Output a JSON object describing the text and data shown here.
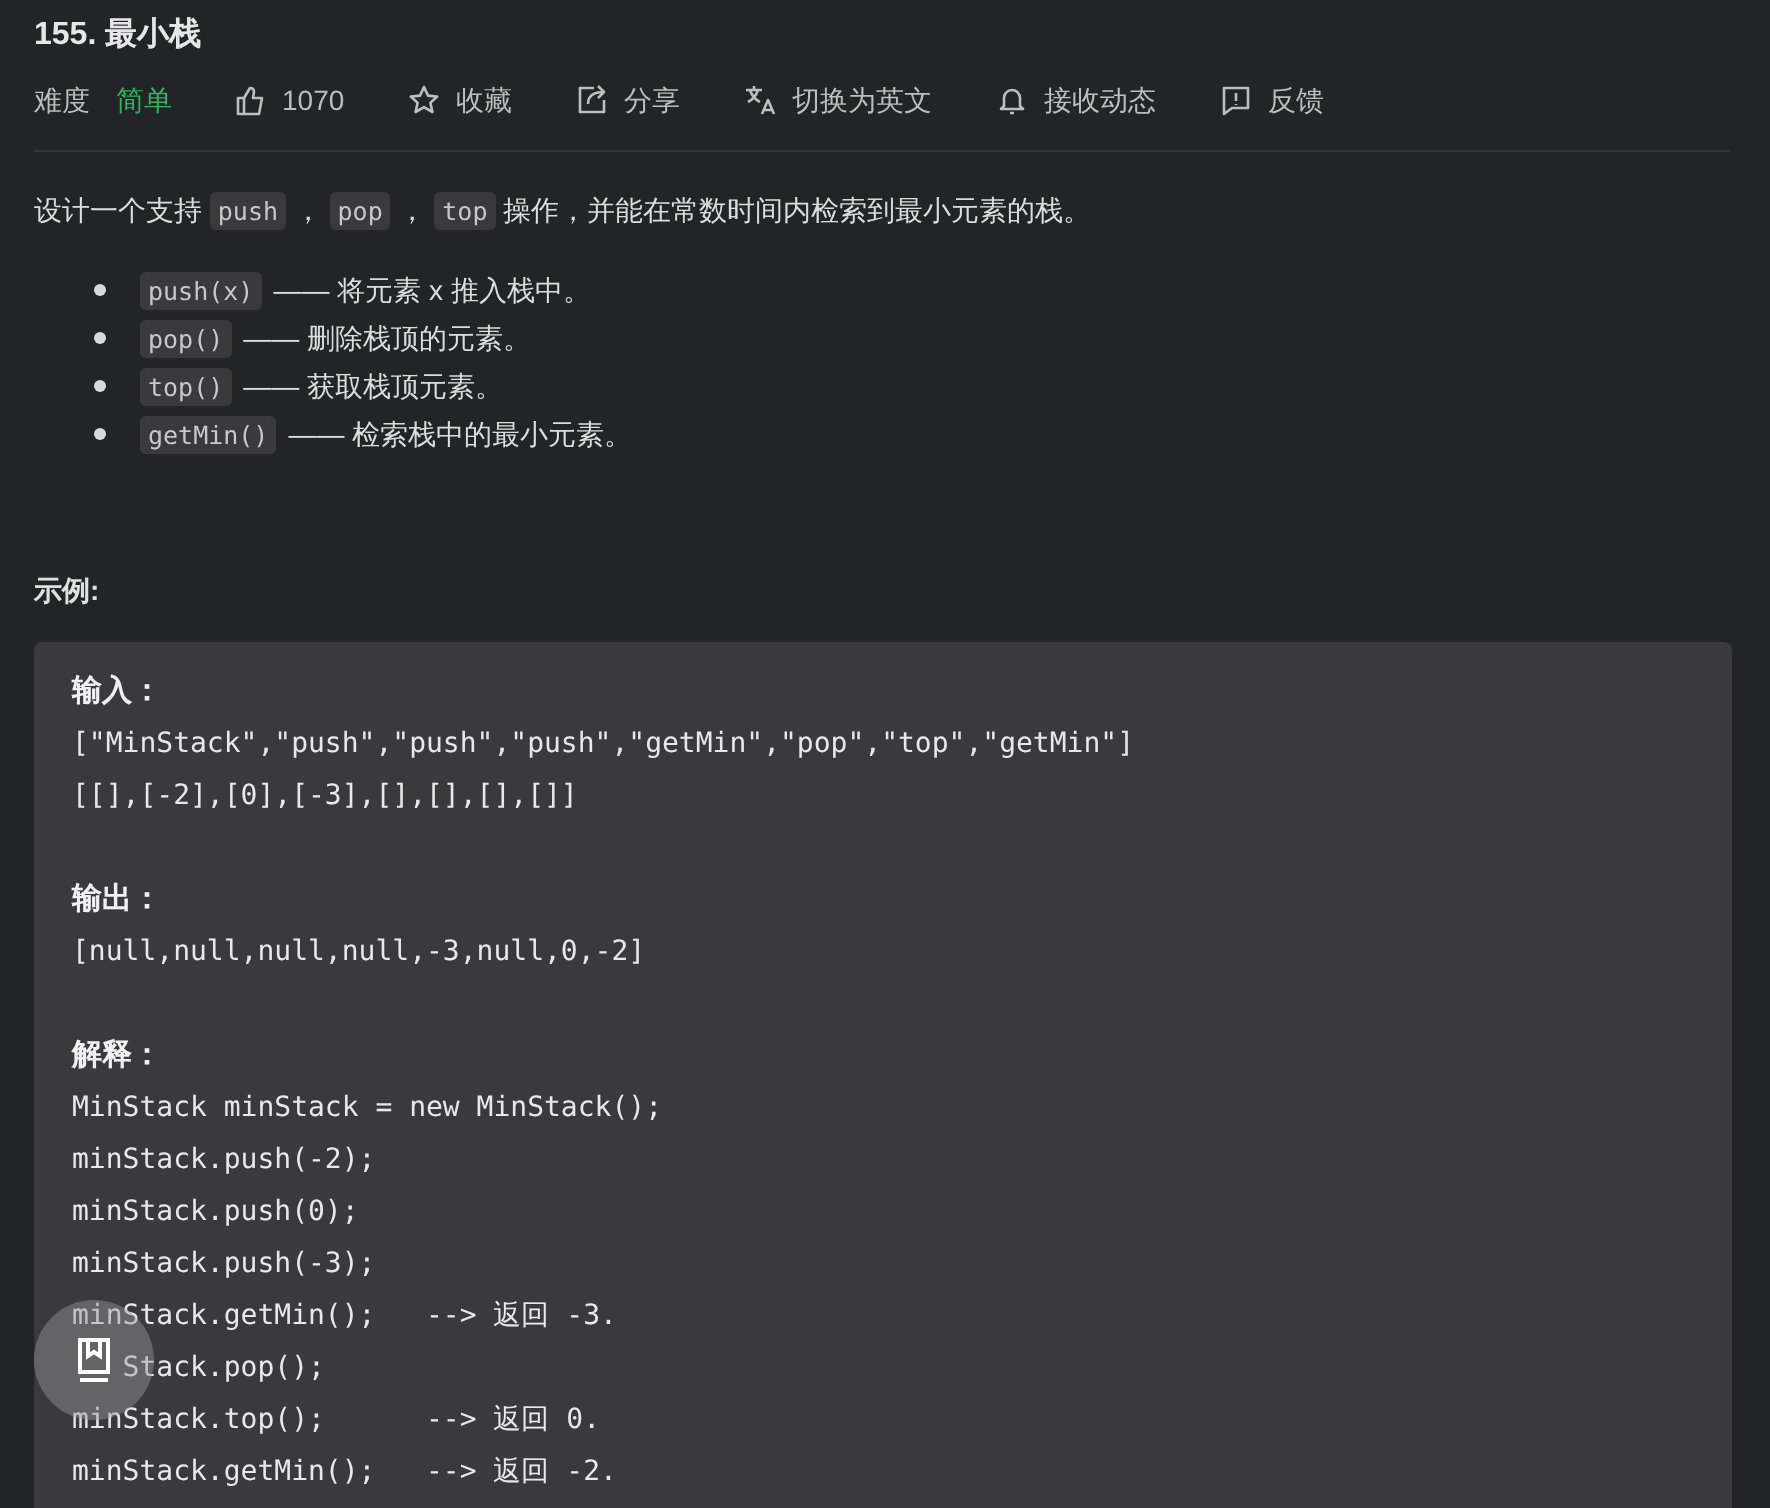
{
  "title": "155. 最小栈",
  "meta": {
    "difficulty_label": "难度",
    "difficulty": "简单",
    "actions": [
      {
        "kind": "like",
        "label": "1070"
      },
      {
        "kind": "star",
        "label": "收藏"
      },
      {
        "kind": "share",
        "label": "分享"
      },
      {
        "kind": "translate",
        "label": "切换为英文"
      },
      {
        "kind": "bell",
        "label": "接收动态"
      },
      {
        "kind": "feedback",
        "label": "反馈"
      }
    ]
  },
  "description": [
    {
      "kind": "text",
      "text": "设计一个支持 "
    },
    {
      "kind": "code",
      "text": "push"
    },
    {
      "kind": "text",
      "text": " ， "
    },
    {
      "kind": "code",
      "text": "pop"
    },
    {
      "kind": "text",
      "text": " ， "
    },
    {
      "kind": "code",
      "text": "top"
    },
    {
      "kind": "text",
      "text": " 操作，并能在常数时间内检索到最小元素的栈。"
    }
  ],
  "bullets": [
    {
      "code": "push(x)",
      "text": "—— 将元素 x 推入栈中。"
    },
    {
      "code": "pop()",
      "text": "—— 删除栈顶的元素。"
    },
    {
      "code": "top()",
      "text": "—— 获取栈顶元素。"
    },
    {
      "code": "getMin()",
      "text": "—— 检索栈中的最小元素。"
    }
  ],
  "example_heading": "示例:",
  "example": [
    {
      "label": "输入：",
      "lines": [
        "[\"MinStack\",\"push\",\"push\",\"push\",\"getMin\",\"pop\",\"top\",\"getMin\"]",
        "[[],[-2],[0],[-3],[],[],[],[]]"
      ]
    },
    {
      "label": "输出：",
      "lines": [
        "[null,null,null,null,-3,null,0,-2]"
      ]
    },
    {
      "label": "解释：",
      "lines": [
        "MinStack minStack = new MinStack();",
        "minStack.push(-2);",
        "minStack.push(0);",
        "minStack.push(-3);",
        "minStack.getMin();   --> 返回 -3.",
        {
          "kind": "partly_covered",
          "text": "Stack.pop();"
        },
        "minStack.top();      --> 返回 0.",
        "minStack.getMin();   --> 返回 -2."
      ]
    }
  ]
}
